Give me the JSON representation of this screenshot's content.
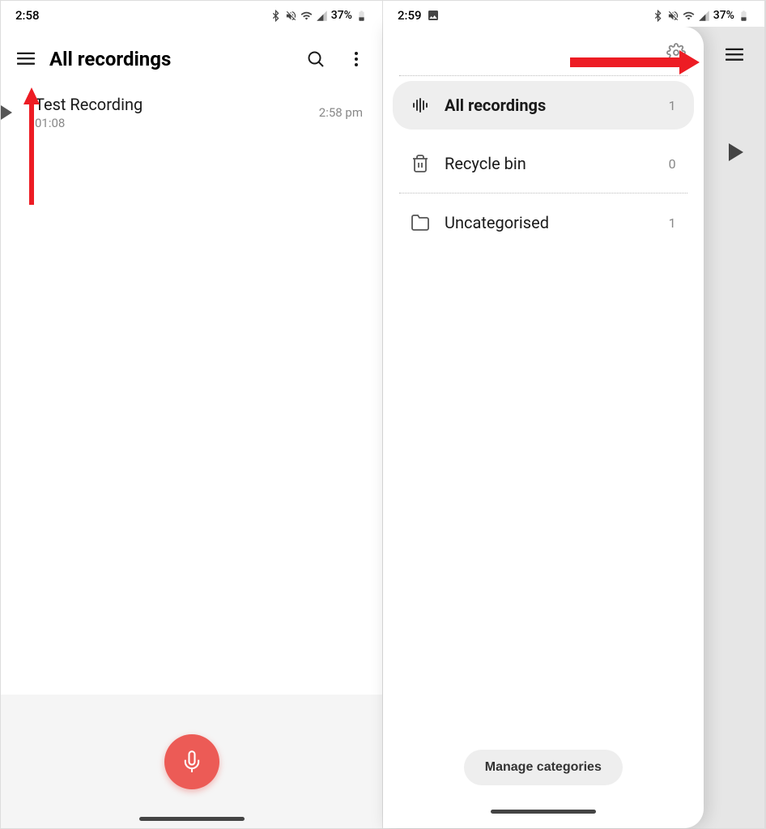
{
  "screen1": {
    "status": {
      "time": "2:58",
      "battery": "37%"
    },
    "header": {
      "title": "All recordings"
    },
    "recording": {
      "name": "Test Recording",
      "duration": "01:08",
      "timestamp": "2:58 pm"
    }
  },
  "screen2": {
    "status": {
      "time": "2:59",
      "battery": "37%"
    },
    "drawer": {
      "items": [
        {
          "label": "All recordings",
          "count": "1"
        },
        {
          "label": "Recycle bin",
          "count": "0"
        },
        {
          "label": "Uncategorised",
          "count": "1"
        }
      ],
      "manage_label": "Manage categories"
    }
  }
}
